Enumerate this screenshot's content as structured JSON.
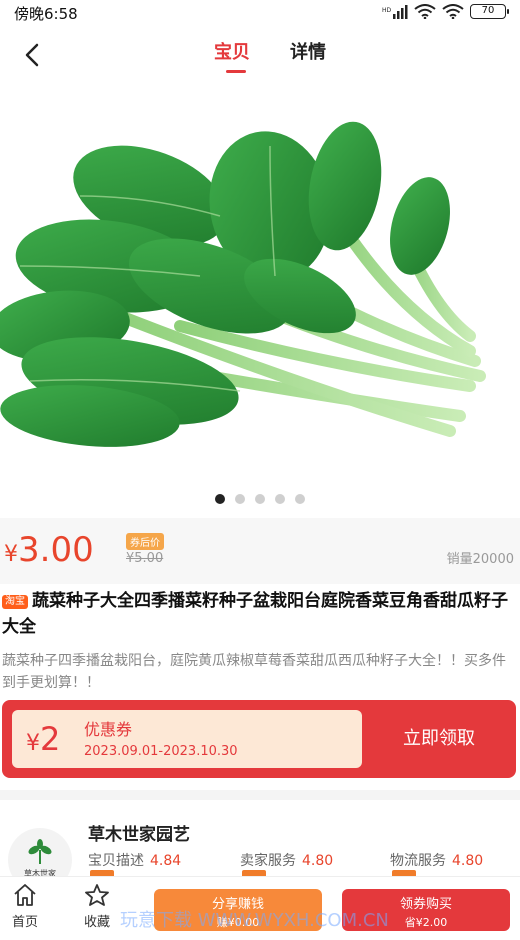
{
  "status_bar": {
    "time": "傍晚6:58",
    "battery": "70"
  },
  "header": {
    "tabs": [
      "宝贝",
      "详情"
    ]
  },
  "gallery": {
    "image_name": "green-vegetable-photo",
    "dot_count": 5,
    "active_dot": 1
  },
  "price": {
    "currency": "¥",
    "value": "3.00",
    "after_coupon_tag": "券后价",
    "original": "¥5.00",
    "sales": "销量20000"
  },
  "product": {
    "platform_tag": "淘宝",
    "title": "蔬菜种子大全四季播菜籽种子盆栽阳台庭院香菜豆角香甜瓜籽子大全",
    "description": "蔬菜种子四季播盆栽阳台，庭院黄瓜辣椒草莓香菜甜瓜西瓜种籽子大全！！买多件到手更划算！！"
  },
  "coupon": {
    "currency": "¥",
    "amount": "2",
    "title": "优惠券",
    "dates": "2023.09.01-2023.10.30",
    "action": "立即领取"
  },
  "store": {
    "name": "草木世家园艺",
    "logo_text": "草木世家",
    "ratings": [
      {
        "label": "宝贝描述",
        "score": "4.84"
      },
      {
        "label": "卖家服务",
        "score": "4.80"
      },
      {
        "label": "物流服务",
        "score": "4.80"
      }
    ]
  },
  "bottom_bar": {
    "home_label": "首页",
    "favorite_label": "收藏",
    "share_label": "分享赚钱",
    "share_sub": "赚¥0.00",
    "buy_label": "领券购买",
    "buy_sub": "省¥2.00"
  },
  "watermark": "玩意下载 WWW.WYXH.COM.CN",
  "colors": {
    "accent": "#e4393c",
    "orange": "#f7893a",
    "price": "#e8452c"
  }
}
